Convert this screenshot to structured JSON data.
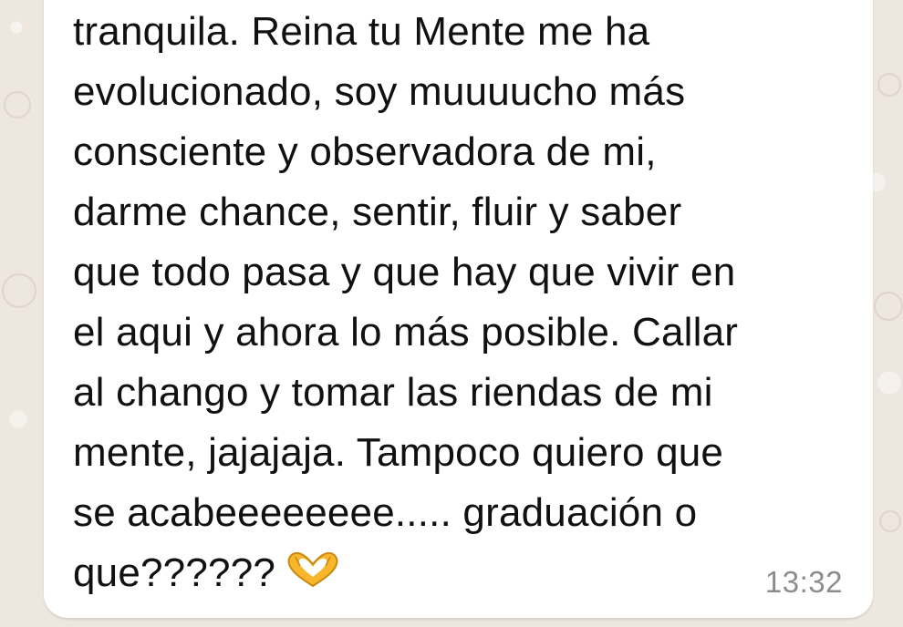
{
  "message": {
    "text": "tranquila. Reina tu Mente me ha\nevolucionado, soy muuuucho más\nconsciente y observadora de mi,\ndarme chance, sentir, fluir y saber\nque todo pasa y que hay que vivir en\nel aqui y ahora lo más posible. Callar\nal chango y tomar las riendas de mi\nmente, jajajaja. Tampoco quiero que\nse acabeeeeeeee..... graduación o\nque??????",
    "emoji": "heart-hands-emoji",
    "time": "13:32"
  },
  "colors": {
    "wallpaper": "#EDE7DF",
    "bubble": "#FFFFFF",
    "text": "#111111",
    "timestamp": "#8C8C8C",
    "emoji": "#F7B62B"
  }
}
